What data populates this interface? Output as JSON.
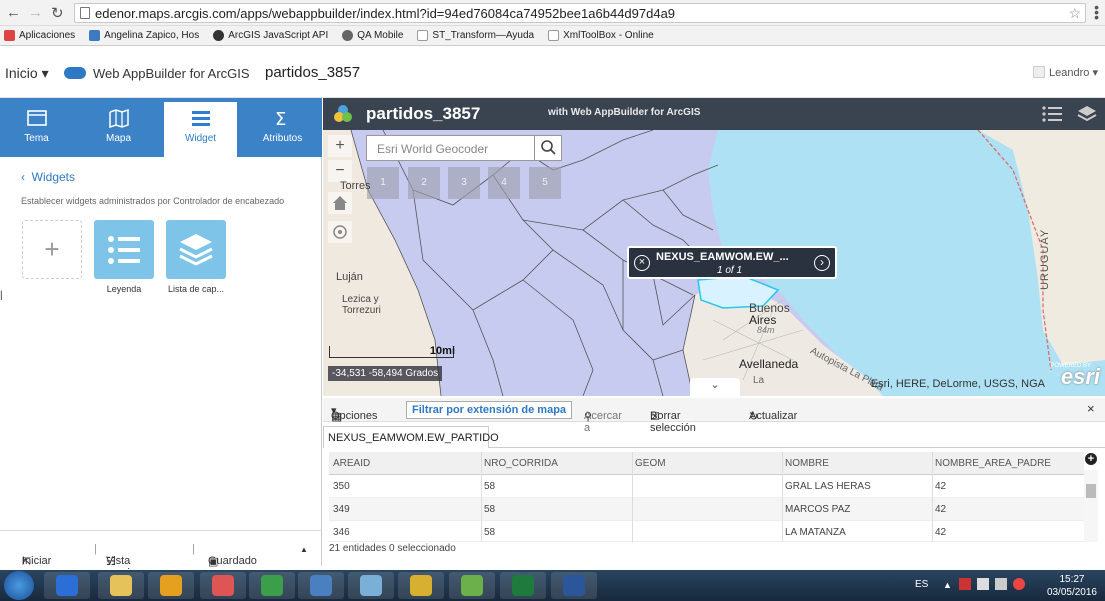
{
  "browser": {
    "url": "edenor.maps.arcgis.com/apps/webappbuilder/index.html?id=94ed76084ca74952bee1a6b44d97d4a9",
    "bookmarks": [
      {
        "label": "Aplicaciones",
        "color": "#d44"
      },
      {
        "label": "Angelina Zapico, Hos",
        "color": "#3c7bbf"
      },
      {
        "label": "ArcGIS JavaScript API",
        "color": "#333"
      },
      {
        "label": "QA Mobile",
        "color": "#666"
      },
      {
        "label": "ST_Transform—Ayuda",
        "color": "#999"
      },
      {
        "label": "XmlToolBox - Online",
        "color": "#999"
      }
    ]
  },
  "wab_header": {
    "inicio": "Inicio",
    "brand": "Web AppBuilder for ArcGIS",
    "app_title": "partidos_3857",
    "user": "Leandro"
  },
  "left_panel": {
    "tabs": [
      {
        "label": "Tema",
        "icon": "theme-icon"
      },
      {
        "label": "Mapa",
        "icon": "map-icon"
      },
      {
        "label": "Widget",
        "icon": "widget-icon"
      },
      {
        "label": "Atributos",
        "icon": "attributes-icon"
      }
    ],
    "back_label": "Widgets",
    "description": "Establecer widgets administrados por Controlador de encabezado",
    "widgets": [
      {
        "label": "",
        "icon": "plus-icon"
      },
      {
        "label": "Leyenda",
        "icon": "legend-icon"
      },
      {
        "label": "Lista de cap...",
        "icon": "layers-icon"
      }
    ],
    "footer": {
      "launch": "Iniciar",
      "preview": "Vista previa",
      "save": "Guardado"
    }
  },
  "map_header": {
    "title": "partidos_3857",
    "subtitle": "with Web AppBuilder for ArcGIS"
  },
  "map": {
    "search_placeholder": "Esri World Geocoder",
    "bookmarks": [
      "1",
      "2",
      "3",
      "4",
      "5"
    ],
    "popup": {
      "title": "NEXUS_EAMWOM.EW_...",
      "count": "1 of 1"
    },
    "scale_label": "10mi",
    "coords": "-34,531 -58,494 Grados",
    "attribution": "Esri, HERE, DeLorme, USGS, NGA",
    "esri_logo": "esri",
    "powered_by": "POWERED BY",
    "labels": {
      "torres": "Torres",
      "lujan": "Luján",
      "lezica": "Lezica y Torrezuri",
      "buenos": "Buenos",
      "aires": "Aires",
      "avellaneda": "Avellaneda",
      "uruguay": "URUGUAY",
      "autopista": "Autopista La Plata",
      "la": "La",
      "r84": "84m"
    }
  },
  "attribute_table": {
    "toolbar": {
      "options": "Opciones",
      "filter": "Filtrar por extensión de mapa",
      "zoom_to": "Acercar a",
      "clear_selection": "Borrar selección",
      "refresh": "Actualizar"
    },
    "tab": "NEXUS_EAMWOM.EW_PARTIDO",
    "columns": [
      "AREAID",
      "NRO_CORRIDA",
      "GEOM",
      "NOMBRE",
      "NOMBRE_AREA_PADRE"
    ],
    "rows": [
      [
        "350",
        "58",
        "",
        "GRAL LAS HERAS",
        "42"
      ],
      [
        "349",
        "58",
        "",
        "MARCOS PAZ",
        "42"
      ],
      [
        "346",
        "58",
        "",
        "LA MATANZA",
        "42"
      ]
    ],
    "footer": "21 entidades 0 seleccionado"
  },
  "taskbar": {
    "lang": "ES",
    "time": "15:27",
    "date": "03/05/2016",
    "apps": [
      {
        "name": "ie",
        "color": "#2b6fd6"
      },
      {
        "name": "explorer",
        "color": "#e5c35a"
      },
      {
        "name": "outlook",
        "color": "#e6a020"
      },
      {
        "name": "media",
        "color": "#d55"
      },
      {
        "name": "chrome",
        "color": "#3a9e4a"
      },
      {
        "name": "app1",
        "color": "#4a80c0"
      },
      {
        "name": "app2",
        "color": "#7ab0d8"
      },
      {
        "name": "app3",
        "color": "#d8b030"
      },
      {
        "name": "app4",
        "color": "#6bb04a"
      },
      {
        "name": "excel",
        "color": "#1f7a3d"
      },
      {
        "name": "word",
        "color": "#2b579a"
      }
    ]
  }
}
